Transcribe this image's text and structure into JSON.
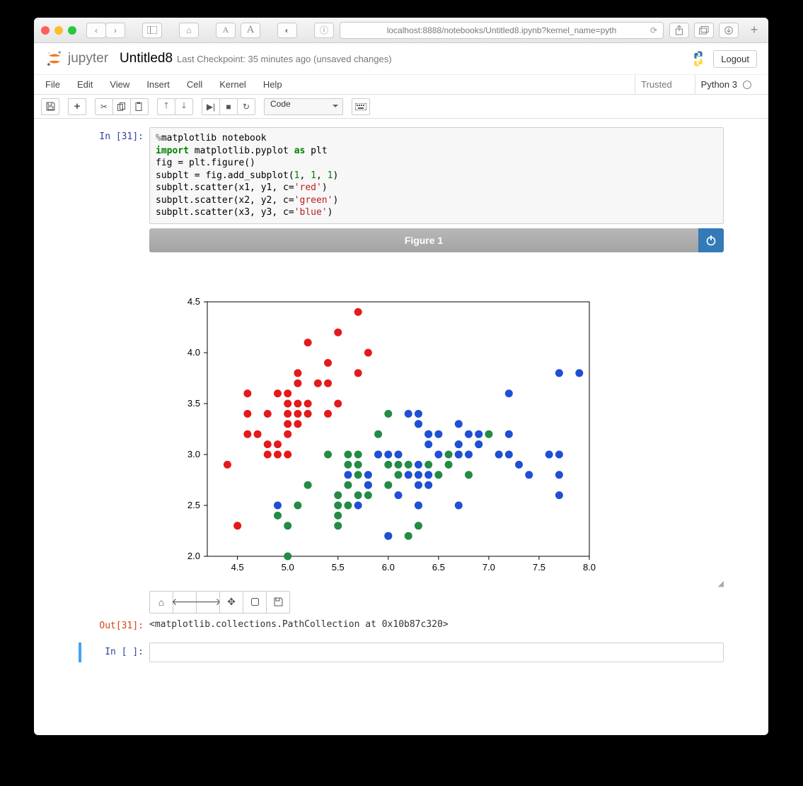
{
  "browser": {
    "url": "localhost:8888/notebooks/Untitled8.ipynb?kernel_name=pyth"
  },
  "header": {
    "logo_text": "jupyter",
    "title": "Untitled8",
    "checkpoint": "Last Checkpoint: 35 minutes ago (unsaved changes)",
    "logout": "Logout"
  },
  "menubar": {
    "items": [
      "File",
      "Edit",
      "View",
      "Insert",
      "Cell",
      "Kernel",
      "Help"
    ],
    "trusted": "Trusted",
    "kernel": "Python 3"
  },
  "toolbar": {
    "celltype": "Code"
  },
  "cell_in": {
    "prompt": "In [31]:",
    "code_lines": [
      {
        "magic": "%",
        "text": "matplotlib notebook"
      },
      {
        "kw": "import",
        "rest": " matplotlib.pyplot ",
        "as": "as",
        "alias": " plt"
      },
      {
        "plain": "fig = plt.figure()"
      },
      {
        "plain": "subplt = fig.add_subplot(",
        "nums": "1, 1, 1",
        "end": ")"
      },
      {
        "plain": "subplt.scatter(x1, y1, c=",
        "str": "'red'",
        "end": ")"
      },
      {
        "plain": "subplt.scatter(x2, y2, c=",
        "str": "'green'",
        "end": ")"
      },
      {
        "plain": "subplt.scatter(x3, y3, c=",
        "str": "'blue'",
        "end": ")"
      }
    ]
  },
  "figure": {
    "title": "Figure 1"
  },
  "cell_out": {
    "prompt": "Out[31]:",
    "text": "<matplotlib.collections.PathCollection at 0x10b87c320>"
  },
  "empty_cell": {
    "prompt": "In [ ]:"
  },
  "chart_data": {
    "type": "scatter",
    "title": "",
    "xlabel": "",
    "ylabel": "",
    "xlim": [
      4.2,
      8.0
    ],
    "ylim": [
      2.0,
      4.5
    ],
    "xticks": [
      4.5,
      5.0,
      5.5,
      6.0,
      6.5,
      7.0,
      7.5,
      8.0
    ],
    "yticks": [
      2.0,
      2.5,
      3.0,
      3.5,
      4.0,
      4.5
    ],
    "series": [
      {
        "name": "red",
        "color": "#e41a1c",
        "points": [
          [
            4.4,
            2.9
          ],
          [
            4.5,
            2.3
          ],
          [
            4.6,
            3.2
          ],
          [
            4.6,
            3.4
          ],
          [
            4.6,
            3.6
          ],
          [
            4.7,
            3.2
          ],
          [
            4.8,
            3.0
          ],
          [
            4.8,
            3.1
          ],
          [
            4.8,
            3.4
          ],
          [
            4.9,
            3.0
          ],
          [
            4.9,
            3.1
          ],
          [
            4.9,
            3.6
          ],
          [
            5.0,
            3.0
          ],
          [
            5.0,
            3.2
          ],
          [
            5.0,
            3.3
          ],
          [
            5.0,
            3.4
          ],
          [
            5.0,
            3.5
          ],
          [
            5.0,
            3.6
          ],
          [
            5.1,
            3.3
          ],
          [
            5.1,
            3.4
          ],
          [
            5.1,
            3.5
          ],
          [
            5.1,
            3.7
          ],
          [
            5.1,
            3.8
          ],
          [
            5.2,
            3.4
          ],
          [
            5.2,
            3.5
          ],
          [
            5.2,
            4.1
          ],
          [
            5.3,
            3.7
          ],
          [
            5.4,
            3.4
          ],
          [
            5.4,
            3.7
          ],
          [
            5.4,
            3.9
          ],
          [
            5.5,
            3.5
          ],
          [
            5.5,
            4.2
          ],
          [
            5.7,
            3.8
          ],
          [
            5.7,
            4.4
          ],
          [
            5.8,
            4.0
          ]
        ]
      },
      {
        "name": "green",
        "color": "#4daf4a",
        "points": [
          [
            4.9,
            2.4
          ],
          [
            5.0,
            2.0
          ],
          [
            5.0,
            2.3
          ],
          [
            5.1,
            2.5
          ],
          [
            5.2,
            2.7
          ],
          [
            5.4,
            3.0
          ],
          [
            5.5,
            2.3
          ],
          [
            5.5,
            2.4
          ],
          [
            5.5,
            2.5
          ],
          [
            5.5,
            2.6
          ],
          [
            5.6,
            2.5
          ],
          [
            5.6,
            2.7
          ],
          [
            5.6,
            2.9
          ],
          [
            5.6,
            3.0
          ],
          [
            5.7,
            2.6
          ],
          [
            5.7,
            2.8
          ],
          [
            5.7,
            2.9
          ],
          [
            5.7,
            3.0
          ],
          [
            5.8,
            2.6
          ],
          [
            5.8,
            2.7
          ],
          [
            5.9,
            3.0
          ],
          [
            5.9,
            3.2
          ],
          [
            6.0,
            2.2
          ],
          [
            6.0,
            2.7
          ],
          [
            6.0,
            2.9
          ],
          [
            6.0,
            3.4
          ],
          [
            6.1,
            2.8
          ],
          [
            6.1,
            2.9
          ],
          [
            6.1,
            3.0
          ],
          [
            6.2,
            2.2
          ],
          [
            6.2,
            2.9
          ],
          [
            6.3,
            2.3
          ],
          [
            6.3,
            2.5
          ],
          [
            6.3,
            3.3
          ],
          [
            6.4,
            2.9
          ],
          [
            6.4,
            3.2
          ],
          [
            6.5,
            2.8
          ],
          [
            6.6,
            2.9
          ],
          [
            6.6,
            3.0
          ],
          [
            6.7,
            3.0
          ],
          [
            6.7,
            3.1
          ],
          [
            6.8,
            2.8
          ],
          [
            6.9,
            3.1
          ],
          [
            7.0,
            3.2
          ]
        ]
      },
      {
        "name": "blue",
        "color": "#377eb8",
        "points": [
          [
            4.9,
            2.5
          ],
          [
            5.6,
            2.8
          ],
          [
            5.7,
            2.5
          ],
          [
            5.8,
            2.7
          ],
          [
            5.8,
            2.8
          ],
          [
            5.9,
            3.0
          ],
          [
            6.0,
            2.2
          ],
          [
            6.0,
            3.0
          ],
          [
            6.1,
            2.6
          ],
          [
            6.1,
            3.0
          ],
          [
            6.2,
            2.8
          ],
          [
            6.2,
            3.4
          ],
          [
            6.3,
            2.5
          ],
          [
            6.3,
            2.7
          ],
          [
            6.3,
            2.8
          ],
          [
            6.3,
            2.9
          ],
          [
            6.3,
            3.3
          ],
          [
            6.3,
            3.4
          ],
          [
            6.4,
            2.7
          ],
          [
            6.4,
            2.8
          ],
          [
            6.4,
            3.1
          ],
          [
            6.4,
            3.2
          ],
          [
            6.5,
            3.0
          ],
          [
            6.5,
            3.2
          ],
          [
            6.7,
            2.5
          ],
          [
            6.7,
            3.0
          ],
          [
            6.7,
            3.1
          ],
          [
            6.7,
            3.3
          ],
          [
            6.8,
            3.0
          ],
          [
            6.8,
            3.2
          ],
          [
            6.9,
            3.1
          ],
          [
            6.9,
            3.2
          ],
          [
            7.1,
            3.0
          ],
          [
            7.2,
            3.0
          ],
          [
            7.2,
            3.2
          ],
          [
            7.2,
            3.6
          ],
          [
            7.3,
            2.9
          ],
          [
            7.4,
            2.8
          ],
          [
            7.6,
            3.0
          ],
          [
            7.7,
            2.6
          ],
          [
            7.7,
            2.8
          ],
          [
            7.7,
            3.0
          ],
          [
            7.7,
            3.8
          ],
          [
            7.9,
            3.8
          ]
        ]
      }
    ]
  }
}
